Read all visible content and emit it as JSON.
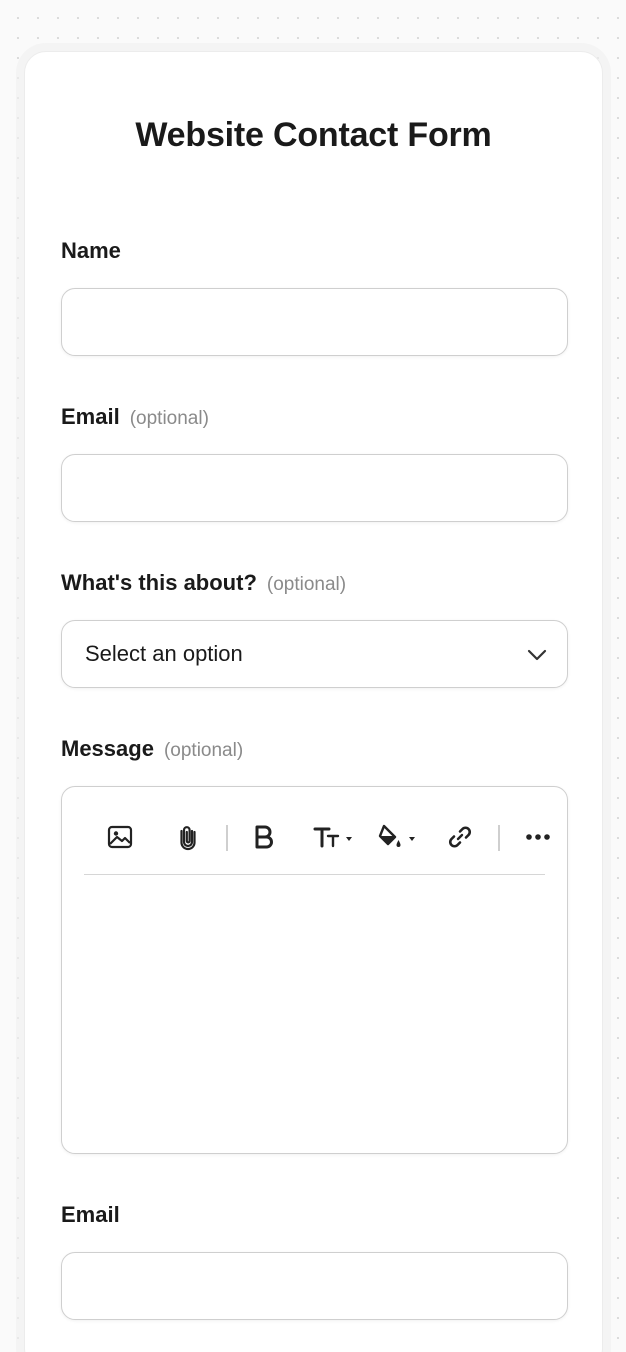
{
  "form": {
    "title": "Website Contact Form",
    "name_label": "Name",
    "email_label": "Email",
    "email_optional": "(optional)",
    "topic_label": "What's this about?",
    "topic_optional": "(optional)",
    "topic_placeholder": "Select an option",
    "message_label": "Message",
    "message_optional": "(optional)",
    "email2_label": "Email"
  },
  "toolbar": {
    "icons": [
      "image-icon",
      "attachment-icon",
      "bold-icon",
      "text-size-icon",
      "fill-color-icon",
      "link-icon",
      "more-icon"
    ]
  },
  "colors": {
    "text": "#1a1a1a",
    "muted": "#8a8a8a",
    "border": "#cfcfcf"
  }
}
